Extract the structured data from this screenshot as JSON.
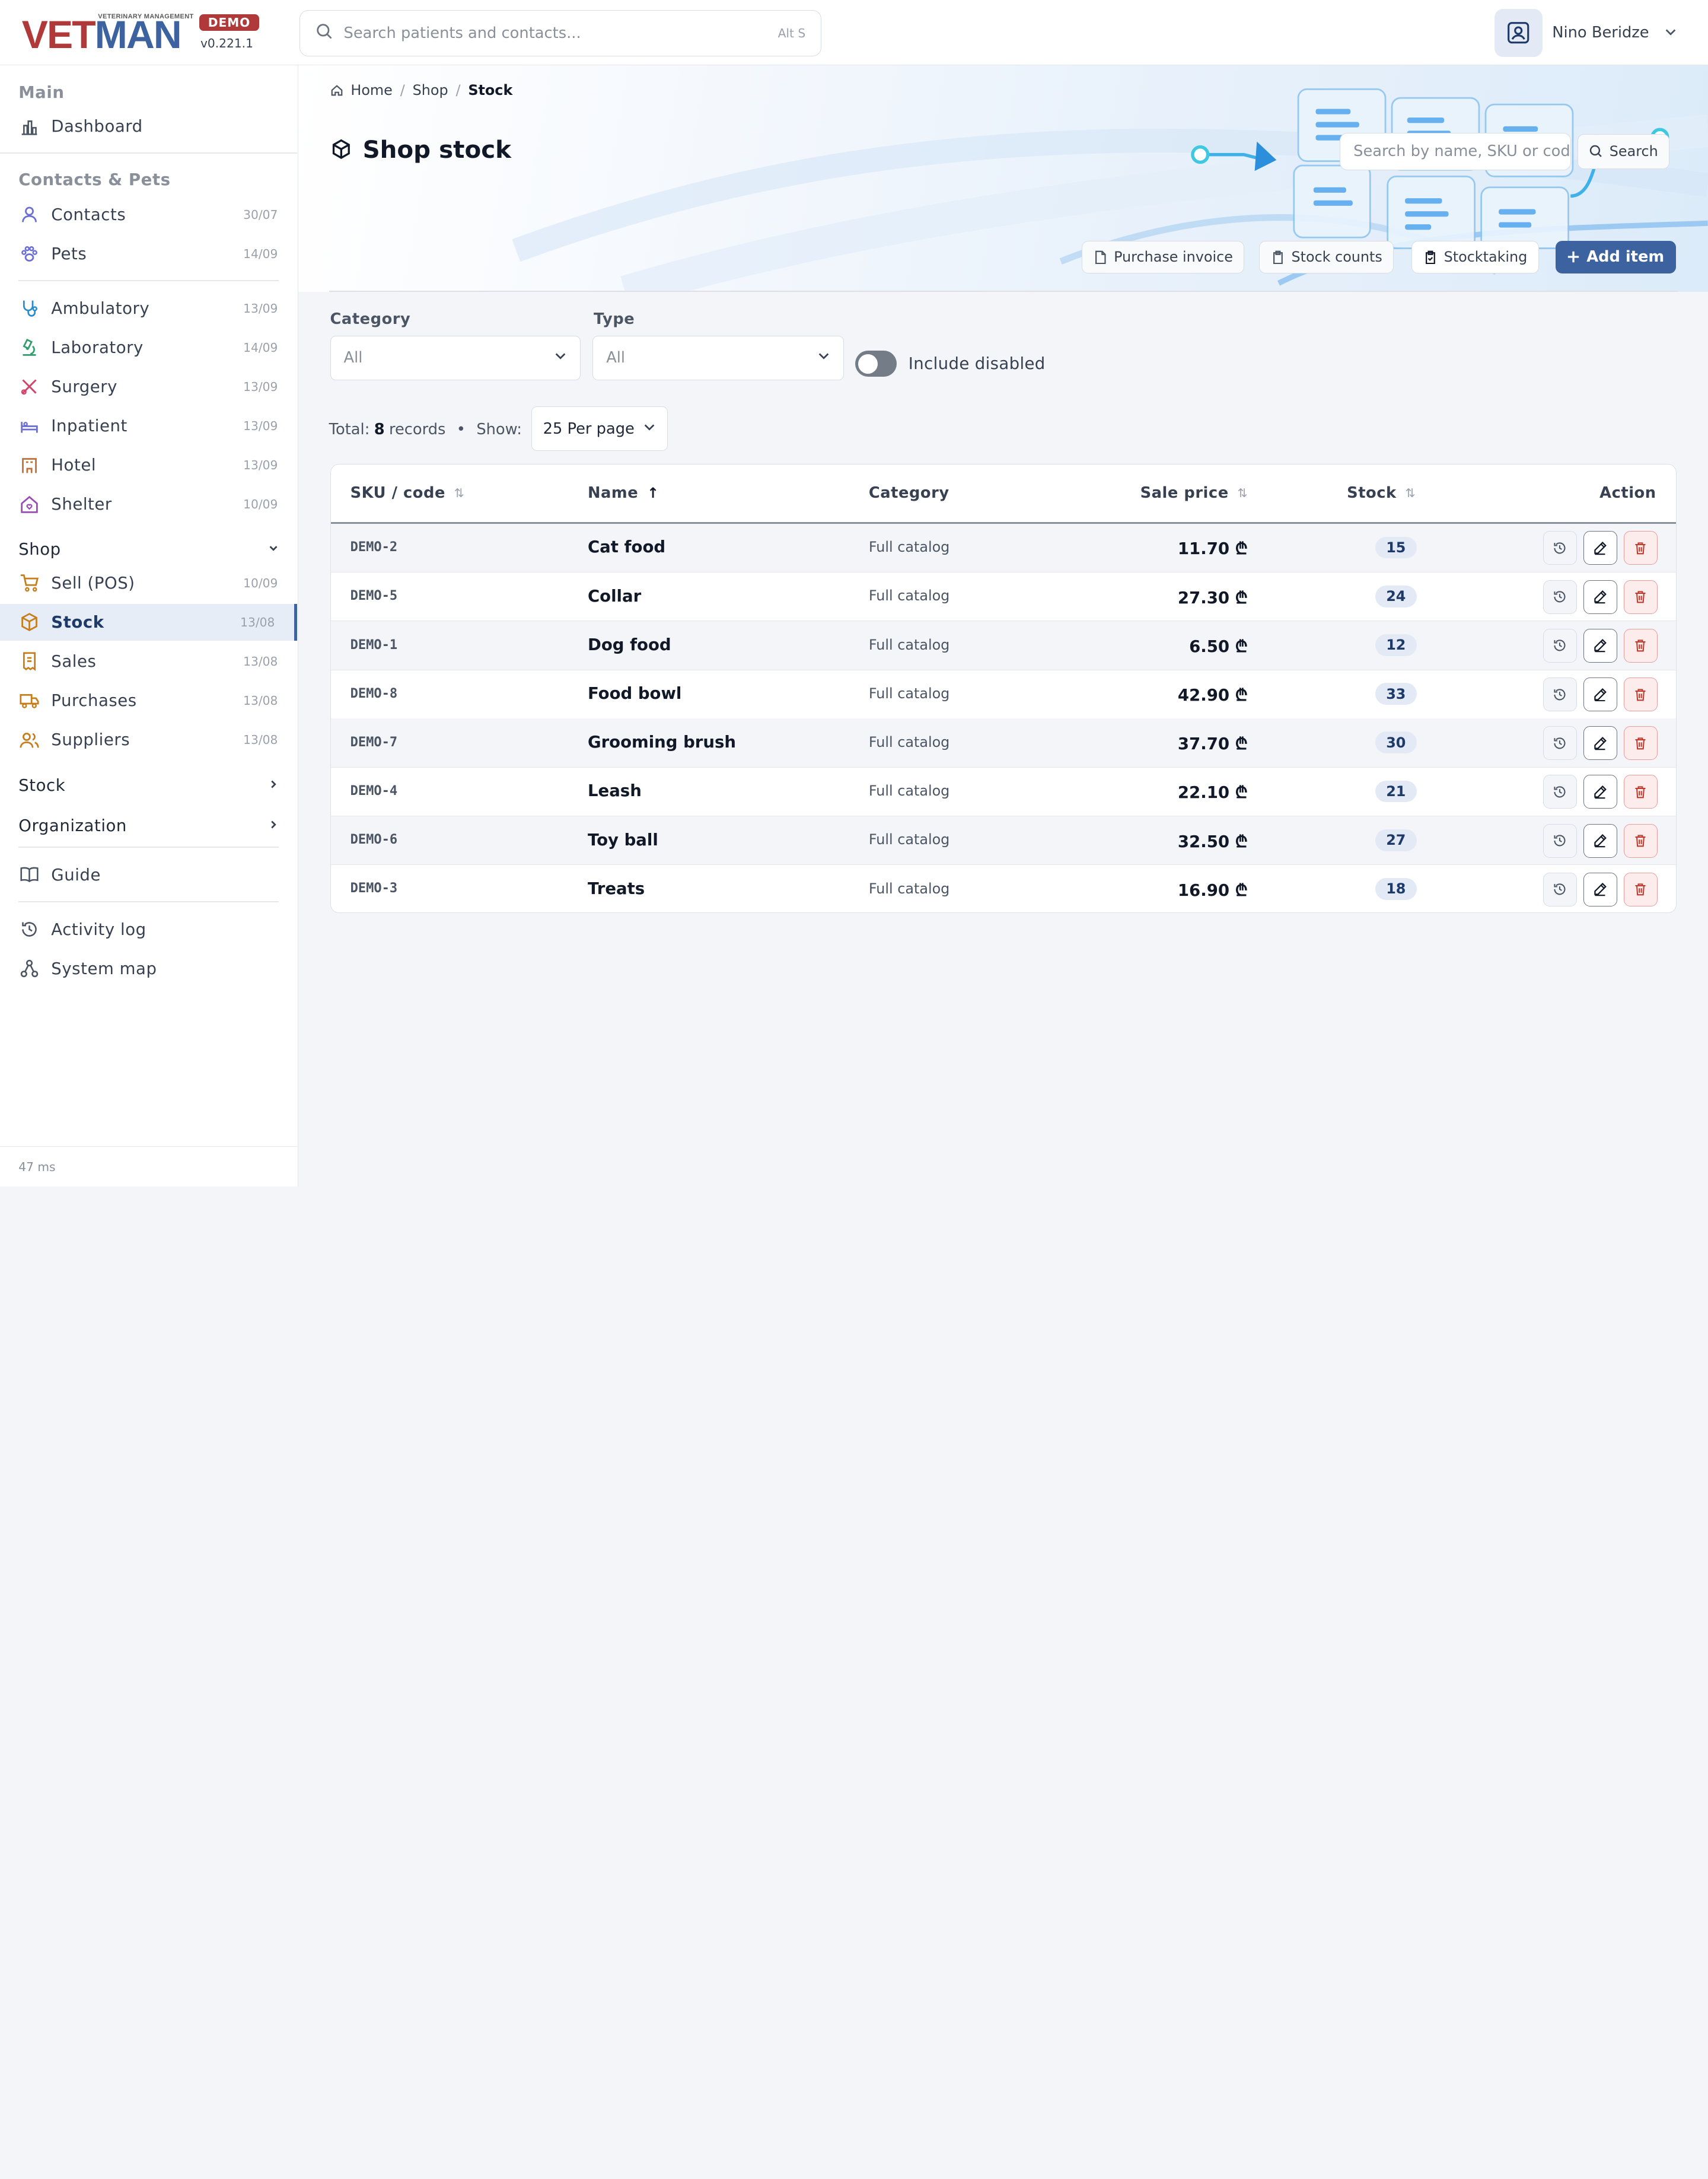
{
  "app": {
    "tagline": "VETERINARY MANAGEMENT",
    "logo_vet": "VET",
    "logo_man": "MAN",
    "demo_badge": "DEMO",
    "version": "v0.221.1"
  },
  "topbar": {
    "search_placeholder": "Search patients and contacts...",
    "search_shortcut": "Alt S",
    "user_name": "Nino Beridze"
  },
  "sidebar": {
    "sections": {
      "main": "Main",
      "contacts_pets": "Contacts & Pets"
    },
    "items": [
      {
        "label": "Dashboard",
        "date": "",
        "icon": "chart-bar-icon",
        "color": "#4b5563"
      },
      {
        "label": "Contacts",
        "date": "30/07",
        "icon": "user-icon",
        "color": "#6b6fd4"
      },
      {
        "label": "Pets",
        "date": "14/09",
        "icon": "paw-icon",
        "color": "#6b6fd4"
      },
      {
        "label": "Ambulatory",
        "date": "13/09",
        "icon": "stethoscope-icon",
        "color": "#2a8ccf"
      },
      {
        "label": "Laboratory",
        "date": "14/09",
        "icon": "microscope-icon",
        "color": "#2f9e6a"
      },
      {
        "label": "Surgery",
        "date": "13/09",
        "icon": "scalpel-icon",
        "color": "#d2436b"
      },
      {
        "label": "Inpatient",
        "date": "13/09",
        "icon": "bed-icon",
        "color": "#6b6fd4"
      },
      {
        "label": "Hotel",
        "date": "13/09",
        "icon": "building-icon",
        "color": "#c0703a"
      },
      {
        "label": "Shelter",
        "date": "10/09",
        "icon": "house-heart-icon",
        "color": "#9b4ab8"
      },
      {
        "label": "Sell (POS)",
        "date": "10/09",
        "icon": "cart-icon",
        "color": "#c77d1a"
      },
      {
        "label": "Stock",
        "date": "13/08",
        "icon": "box-icon",
        "color": "#c77d1a"
      },
      {
        "label": "Sales",
        "date": "13/08",
        "icon": "receipt-icon",
        "color": "#c77d1a"
      },
      {
        "label": "Purchases",
        "date": "13/08",
        "icon": "truck-icon",
        "color": "#c77d1a"
      },
      {
        "label": "Suppliers",
        "date": "13/08",
        "icon": "users-icon",
        "color": "#c77d1a"
      }
    ],
    "groups": {
      "shop": "Shop",
      "stock": "Stock",
      "organization": "Organization"
    },
    "bottom": [
      {
        "label": "Guide",
        "icon": "book-icon"
      },
      {
        "label": "Activity log",
        "icon": "history-icon"
      },
      {
        "label": "System map",
        "icon": "sitemap-icon"
      }
    ],
    "footer": "47 ms"
  },
  "breadcrumb": {
    "home": "Home",
    "shop": "Shop",
    "current": "Stock"
  },
  "page": {
    "title": "Shop stock",
    "search_placeholder": "Search by name, SKU or code",
    "search_button": "Search",
    "btn_purchase_invoice": "Purchase invoice",
    "btn_stock_counts": "Stock counts",
    "btn_stocktaking": "Stocktaking",
    "btn_add_item": "Add item"
  },
  "filters": {
    "category_label": "Category",
    "category_value": "All",
    "type_label": "Type",
    "type_value": "All",
    "include_disabled": "Include disabled",
    "include_disabled_on": false
  },
  "summary": {
    "total_prefix": "Total:",
    "total_count": "8",
    "total_suffix": "records",
    "bullet": "•",
    "show_label": "Show:",
    "per_page": "25 Per page"
  },
  "table": {
    "columns": {
      "sku": "SKU / code",
      "name": "Name",
      "category": "Category",
      "price": "Sale price",
      "stock": "Stock",
      "action": "Action"
    },
    "currency": "₾",
    "rows": [
      {
        "sku": "DEMO-2",
        "name": "Cat food",
        "category": "Full catalog",
        "price": "11.70 ₾",
        "stock": "15"
      },
      {
        "sku": "DEMO-5",
        "name": "Collar",
        "category": "Full catalog",
        "price": "27.30 ₾",
        "stock": "24"
      },
      {
        "sku": "DEMO-1",
        "name": "Dog food",
        "category": "Full catalog",
        "price": "6.50 ₾",
        "stock": "12"
      },
      {
        "sku": "DEMO-8",
        "name": "Food bowl",
        "category": "Full catalog",
        "price": "42.90 ₾",
        "stock": "33"
      },
      {
        "sku": "DEMO-7",
        "name": "Grooming brush",
        "category": "Full catalog",
        "price": "37.70 ₾",
        "stock": "30"
      },
      {
        "sku": "DEMO-4",
        "name": "Leash",
        "category": "Full catalog",
        "price": "22.10 ₾",
        "stock": "21"
      },
      {
        "sku": "DEMO-6",
        "name": "Toy ball",
        "category": "Full catalog",
        "price": "32.50 ₾",
        "stock": "27"
      },
      {
        "sku": "DEMO-3",
        "name": "Treats",
        "category": "Full catalog",
        "price": "16.90 ₾",
        "stock": "18"
      }
    ]
  },
  "colors": {
    "brand_red": "#b03a3a",
    "brand_blue": "#3c63a0",
    "active_bg": "#e6edf6"
  }
}
